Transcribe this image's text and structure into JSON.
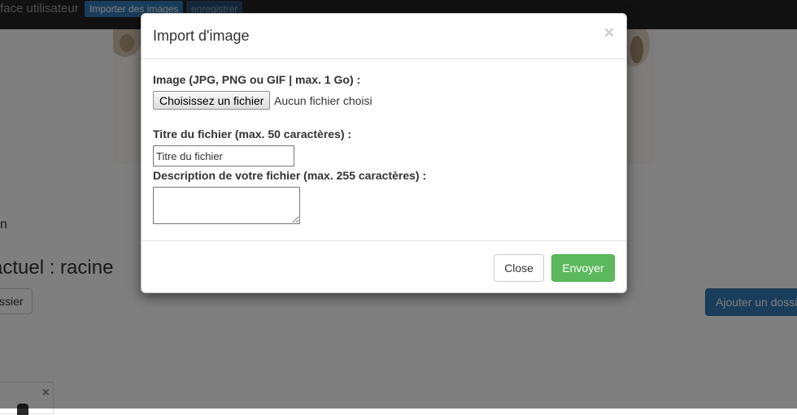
{
  "navbar": {
    "brand": "face utilisateur",
    "import_label": "Importer des images",
    "save_label": "enregistrer"
  },
  "background": {
    "text_left": "n",
    "heading": "actuel : racine",
    "left_button": "ssier",
    "right_button": "Ajouter un dossi",
    "thumb_close": "×"
  },
  "modal": {
    "title": "Import d'image",
    "close_glyph": "×",
    "image_label": "Image (JPG, PNG ou GIF | max. 1 Go) :",
    "file_button": "Choisissez un fichier",
    "file_status": "Aucun fichier choisi",
    "title_label": "Titre du fichier (max. 50 caractères) :",
    "title_value": "Titre du fichier",
    "description_label": "Description de votre fichier (max. 255 caractères) :",
    "description_value": "",
    "close_button": "Close",
    "send_button": "Envoyer"
  },
  "colors": {
    "navbar": "#222222",
    "primary": "#337ab7",
    "success": "#5cb85c",
    "backdrop": "rgba(0,0,0,0.5)"
  },
  "icons": {
    "modal_close": "close-icon",
    "thumb_close": "close-icon"
  }
}
